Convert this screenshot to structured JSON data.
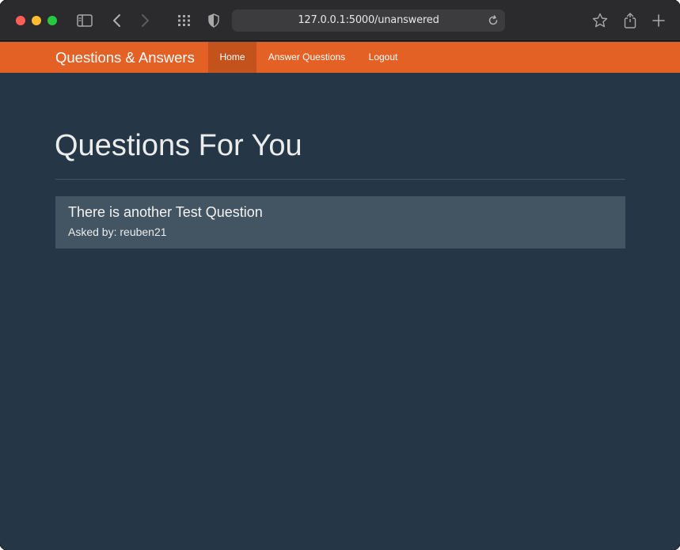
{
  "browser": {
    "url": "127.0.0.1:5000/unanswered"
  },
  "navbar": {
    "brand": "Questions & Answers",
    "items": [
      {
        "label": "Home",
        "active": true
      },
      {
        "label": "Answer Questions",
        "active": false
      },
      {
        "label": "Logout",
        "active": false
      }
    ]
  },
  "main": {
    "title": "Questions For You",
    "questions": [
      {
        "title": "There is another Test Question",
        "asked_by": "Asked by: reuben21"
      }
    ]
  },
  "colors": {
    "navbar": "#e46125",
    "navbar_active": "#c4521d",
    "background": "#253746",
    "card": "#435562"
  },
  "icons": [
    "sidebar-icon",
    "back-icon",
    "forward-icon",
    "tab-grid-icon",
    "shield-icon",
    "reload-icon",
    "star-icon",
    "share-icon",
    "new-tab-icon"
  ]
}
